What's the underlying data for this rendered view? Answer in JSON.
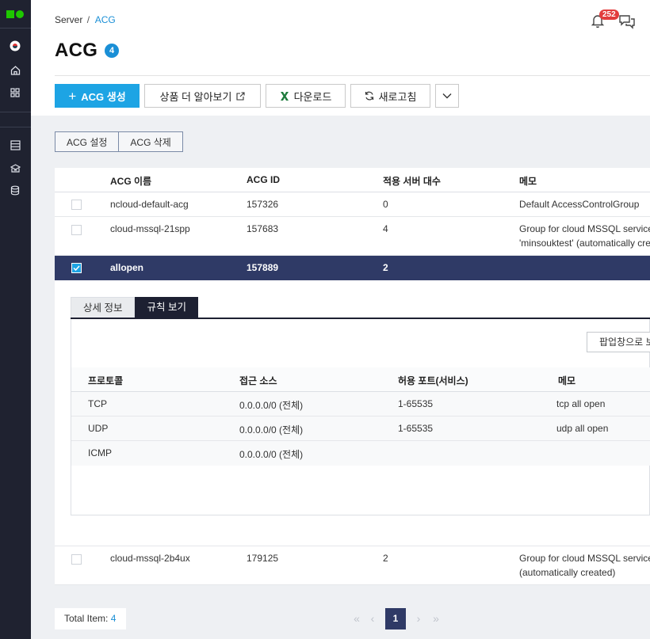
{
  "breadcrumb": {
    "parent": "Server",
    "separator": "/",
    "current": "ACG"
  },
  "header": {
    "notification_count": "252",
    "title": "ACG",
    "count": "4"
  },
  "toolbar": {
    "create_label": "ACG 생성",
    "learn_more_label": "상품 더 알아보기",
    "download_label": "다운로드",
    "refresh_label": "새로고침"
  },
  "actions": {
    "settings_label": "ACG 설정",
    "delete_label": "ACG 삭제"
  },
  "table": {
    "headers": [
      "ACG 이름",
      "ACG ID",
      "적용 서버 대수",
      "메모"
    ],
    "rows": [
      {
        "name": "ncloud-default-acg",
        "id": "157326",
        "servers": "0",
        "memo1": "Default AccessControlGroup",
        "memo2": ""
      },
      {
        "name": "cloud-mssql-21spp",
        "id": "157683",
        "servers": "4",
        "memo1": "Group for cloud MSSQL service",
        "memo2": "'minsouktest' (automatically cre"
      },
      {
        "name": "allopen",
        "id": "157889",
        "servers": "2",
        "memo1": "",
        "memo2": ""
      },
      {
        "name": "cloud-mssql-2b4ux",
        "id": "179125",
        "servers": "2",
        "memo1": "Group for cloud MSSQL service",
        "memo2": "(automatically created)"
      }
    ]
  },
  "detail": {
    "tab_info": "상세 정보",
    "tab_rules": "규칙 보기",
    "popup_label": "팝업창으로 보",
    "rule_headers": [
      "프로토콜",
      "접근 소스",
      "허용 포트(서비스)",
      "메모"
    ],
    "rules": [
      {
        "protocol": "TCP",
        "source": "0.0.0.0/0 (전체)",
        "port": "1-65535",
        "memo": "tcp all open"
      },
      {
        "protocol": "UDP",
        "source": "0.0.0.0/0 (전체)",
        "port": "1-65535",
        "memo": "udp all open"
      },
      {
        "protocol": "ICMP",
        "source": "0.0.0.0/0 (전체)",
        "port": "",
        "memo": ""
      }
    ]
  },
  "footer": {
    "total_label": "Total Item:",
    "total_count": "4",
    "current_page": "1"
  },
  "colors": {
    "accent": "#1da4e4",
    "selected_row": "#2f3a66",
    "rail": "#1f2230",
    "logo": "#1ec800"
  }
}
